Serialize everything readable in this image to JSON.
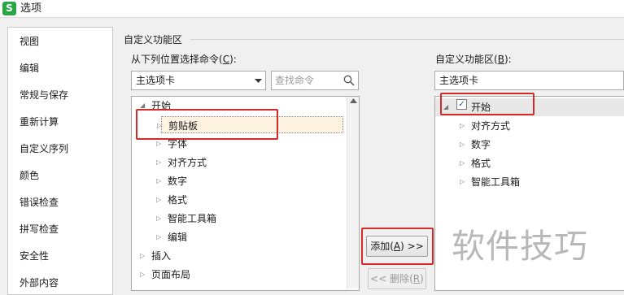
{
  "window": {
    "title": "选项",
    "icon_letter": "S"
  },
  "nav": {
    "items": [
      {
        "label": "视图"
      },
      {
        "label": "编辑"
      },
      {
        "label": "常规与保存"
      },
      {
        "label": "重新计算"
      },
      {
        "label": "自定义序列"
      },
      {
        "label": "颜色"
      },
      {
        "label": "错误检查"
      },
      {
        "label": "拼写检查"
      },
      {
        "label": "安全性"
      },
      {
        "label": "外部内容"
      }
    ]
  },
  "section": {
    "title": "自定义功能区"
  },
  "commands": {
    "label": "从下列位置选择命令",
    "label_key": "C",
    "dropdown_value": "主选项卡",
    "search_placeholder": "查找命令",
    "tree": [
      {
        "label": "开始",
        "expander": "◢"
      },
      {
        "label": "剪贴板",
        "expander": "▷"
      },
      {
        "label": "字体",
        "expander": "▷"
      },
      {
        "label": "对齐方式",
        "expander": "▷"
      },
      {
        "label": "数字",
        "expander": "▷"
      },
      {
        "label": "格式",
        "expander": "▷"
      },
      {
        "label": "智能工具箱",
        "expander": "▷"
      },
      {
        "label": "编辑",
        "expander": "▷"
      },
      {
        "label": "插入",
        "expander": "▷"
      },
      {
        "label": "页面布局",
        "expander": "▷"
      }
    ]
  },
  "buttons": {
    "add": {
      "prefix": "添加(",
      "key": "A",
      "suffix": ") >>"
    },
    "remove": {
      "prefix": "<< 删除(",
      "key": "R",
      "suffix": ")"
    }
  },
  "ribbon": {
    "label": "自定义功能区",
    "label_key": "B",
    "dropdown_value": "主选项卡",
    "tree": [
      {
        "label": "开始",
        "expander": "◢",
        "checked": true
      },
      {
        "label": "对齐方式",
        "expander": "▷"
      },
      {
        "label": "数字",
        "expander": "▷"
      },
      {
        "label": "格式",
        "expander": "▷"
      },
      {
        "label": "智能工具箱",
        "expander": "▷"
      }
    ]
  },
  "watermark": "软件技巧",
  "colors": {
    "highlight": "#d42a2a",
    "app_icon": "#29a745",
    "selected_row": "#fdf3e0"
  }
}
